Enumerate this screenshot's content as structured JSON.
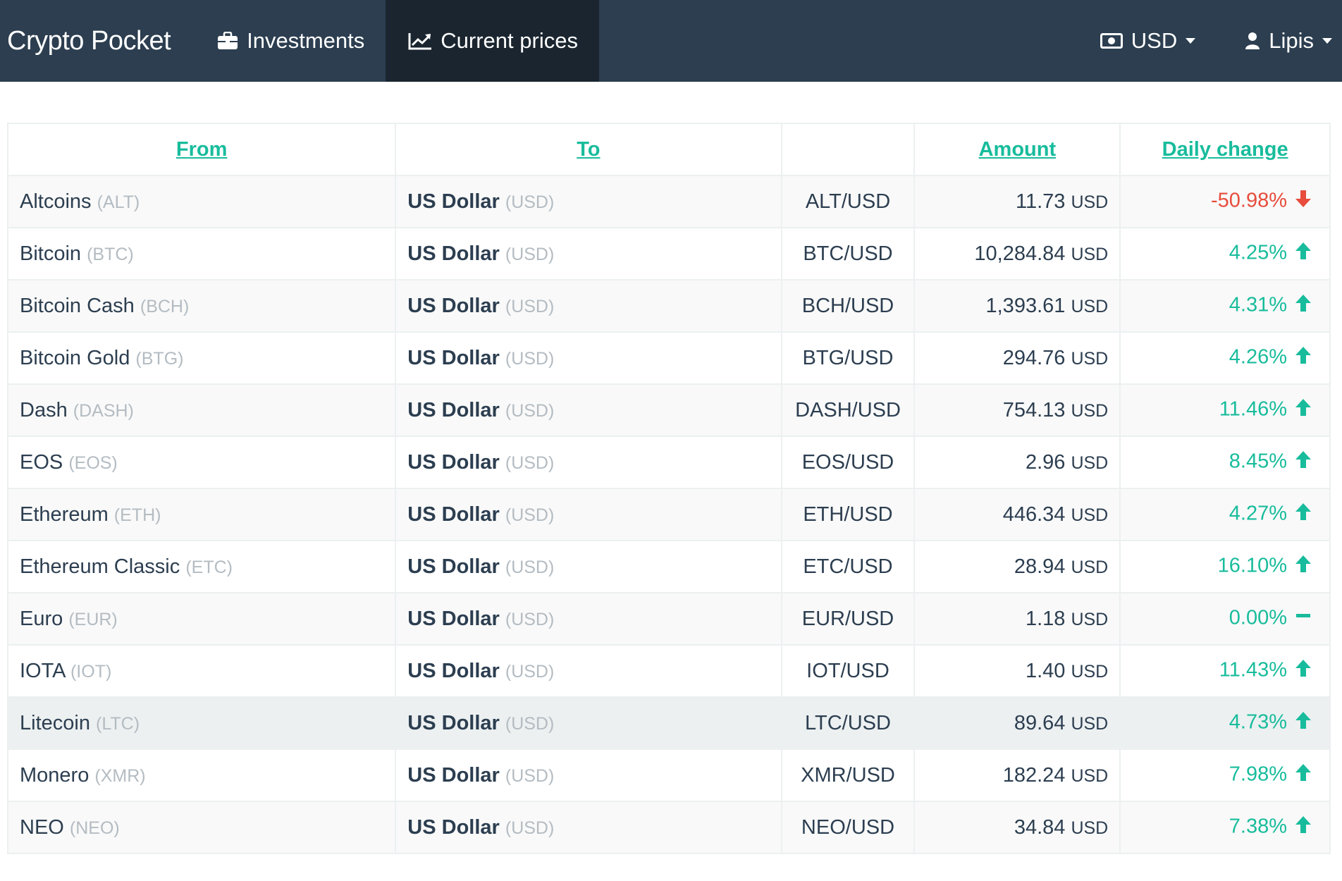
{
  "navbar": {
    "brand": "Crypto Pocket",
    "investments": "Investments",
    "current_prices": "Current prices",
    "currency": "USD",
    "user": "Lipis"
  },
  "table": {
    "headers": {
      "from": "From",
      "to": "To",
      "pair": "",
      "amount": "Amount",
      "daily_change": "Daily change"
    },
    "rows": [
      {
        "from_name": "Altcoins",
        "from_code": "(ALT)",
        "to_name": "US Dollar",
        "to_code": "(USD)",
        "pair": "ALT/USD",
        "amount": "11.73",
        "unit": "USD",
        "change": "-50.98%",
        "trend": "down"
      },
      {
        "from_name": "Bitcoin",
        "from_code": "(BTC)",
        "to_name": "US Dollar",
        "to_code": "(USD)",
        "pair": "BTC/USD",
        "amount": "10,284.84",
        "unit": "USD",
        "change": "4.25%",
        "trend": "up"
      },
      {
        "from_name": "Bitcoin Cash",
        "from_code": "(BCH)",
        "to_name": "US Dollar",
        "to_code": "(USD)",
        "pair": "BCH/USD",
        "amount": "1,393.61",
        "unit": "USD",
        "change": "4.31%",
        "trend": "up"
      },
      {
        "from_name": "Bitcoin Gold",
        "from_code": "(BTG)",
        "to_name": "US Dollar",
        "to_code": "(USD)",
        "pair": "BTG/USD",
        "amount": "294.76",
        "unit": "USD",
        "change": "4.26%",
        "trend": "up"
      },
      {
        "from_name": "Dash",
        "from_code": "(DASH)",
        "to_name": "US Dollar",
        "to_code": "(USD)",
        "pair": "DASH/USD",
        "amount": "754.13",
        "unit": "USD",
        "change": "11.46%",
        "trend": "up"
      },
      {
        "from_name": "EOS",
        "from_code": "(EOS)",
        "to_name": "US Dollar",
        "to_code": "(USD)",
        "pair": "EOS/USD",
        "amount": "2.96",
        "unit": "USD",
        "change": "8.45%",
        "trend": "up"
      },
      {
        "from_name": "Ethereum",
        "from_code": "(ETH)",
        "to_name": "US Dollar",
        "to_code": "(USD)",
        "pair": "ETH/USD",
        "amount": "446.34",
        "unit": "USD",
        "change": "4.27%",
        "trend": "up"
      },
      {
        "from_name": "Ethereum Classic",
        "from_code": "(ETC)",
        "to_name": "US Dollar",
        "to_code": "(USD)",
        "pair": "ETC/USD",
        "amount": "28.94",
        "unit": "USD",
        "change": "16.10%",
        "trend": "up"
      },
      {
        "from_name": "Euro",
        "from_code": "(EUR)",
        "to_name": "US Dollar",
        "to_code": "(USD)",
        "pair": "EUR/USD",
        "amount": "1.18",
        "unit": "USD",
        "change": "0.00%",
        "trend": "flat"
      },
      {
        "from_name": "IOTA",
        "from_code": "(IOT)",
        "to_name": "US Dollar",
        "to_code": "(USD)",
        "pair": "IOT/USD",
        "amount": "1.40",
        "unit": "USD",
        "change": "11.43%",
        "trend": "up"
      },
      {
        "from_name": "Litecoin",
        "from_code": "(LTC)",
        "to_name": "US Dollar",
        "to_code": "(USD)",
        "pair": "LTC/USD",
        "amount": "89.64",
        "unit": "USD",
        "change": "4.73%",
        "trend": "up"
      },
      {
        "from_name": "Monero",
        "from_code": "(XMR)",
        "to_name": "US Dollar",
        "to_code": "(USD)",
        "pair": "XMR/USD",
        "amount": "182.24",
        "unit": "USD",
        "change": "7.98%",
        "trend": "up"
      },
      {
        "from_name": "NEO",
        "from_code": "(NEO)",
        "to_name": "US Dollar",
        "to_code": "(USD)",
        "pair": "NEO/USD",
        "amount": "34.84",
        "unit": "USD",
        "change": "7.38%",
        "trend": "up"
      }
    ]
  },
  "highlighted_row": 10,
  "colors": {
    "up": "#18bc9c",
    "down": "#e74c3c",
    "navbar": "#2c3e50",
    "active_nav": "#1a252f",
    "muted": "#b4bcc2"
  }
}
